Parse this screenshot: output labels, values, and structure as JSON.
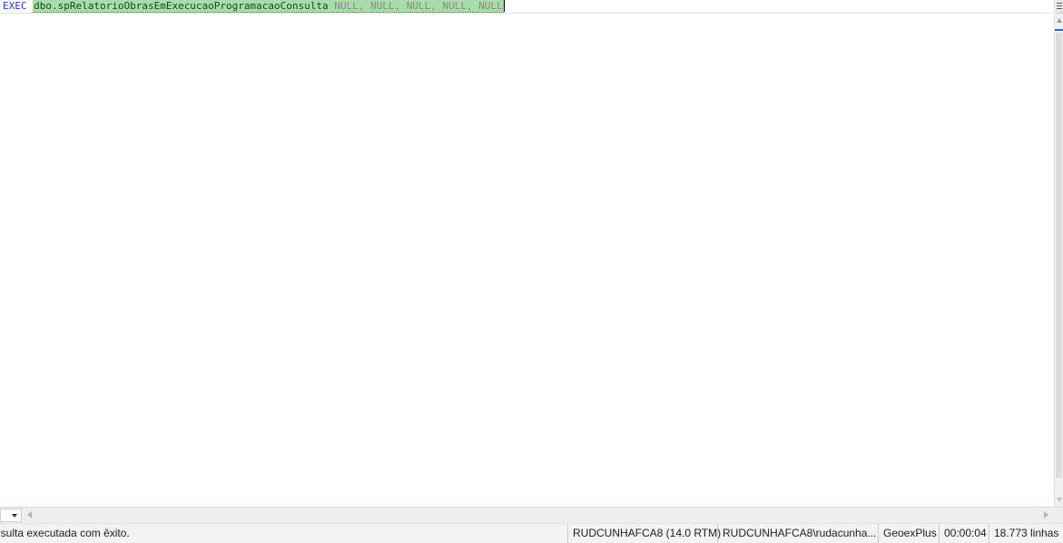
{
  "editor": {
    "keyword": "EXEC",
    "procedure": "dbo.spRelatorioObrasEmExecucaoProgramacaoConsulta",
    "args": "NULL, NULL, NULL, NULL, NULL"
  },
  "status": {
    "message": "nsulta executada com êxito.",
    "server": "RUDCUNHAFCA8 (14.0 RTM)",
    "user": "RUDCUNHAFCA8\\rudacunha...",
    "database": "GeoexPlus",
    "elapsed": "00:00:04",
    "rows": "18.773 linhas"
  },
  "colors": {
    "keyword": "#1f3fcf",
    "selection": "#a8dca8",
    "null_text": "#8a8a8a",
    "status_bg": "#f3f3f3"
  },
  "icons": {
    "split": "split-lines-icon",
    "zoom": "chevron-down-icon",
    "scroll_up": "arrow-up-icon",
    "scroll_down": "arrow-down-icon",
    "scroll_left": "arrow-left-icon",
    "scroll_right": "arrow-right-icon"
  }
}
